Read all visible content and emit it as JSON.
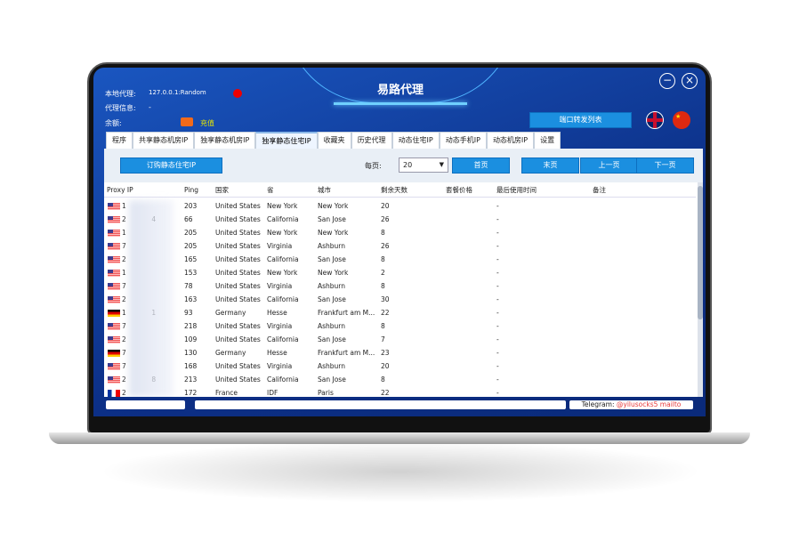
{
  "app": {
    "title": "易路代理"
  },
  "info": {
    "local_proxy_label": "本地代理:",
    "local_proxy_value": "127.0.0.1:Random",
    "proxy_info_label": "代理信息:",
    "proxy_info_value": "-",
    "balance_label": "余额:",
    "recharge_label": "充值"
  },
  "buttons": {
    "port_forward": "端口转发列表",
    "buy": "订购静态住宅IP",
    "first": "首页",
    "last": "末页",
    "prev": "上一页",
    "next": "下一页"
  },
  "per_page": {
    "label": "每页:",
    "value": "20"
  },
  "tabs": [
    "程序",
    "共享静态机房IP",
    "独享静态机房IP",
    "独享静态住宅IP",
    "收藏夹",
    "历史代理",
    "动态住宅IP",
    "动态手机IP",
    "动态机房IP",
    "设置"
  ],
  "active_tab": "独享静态住宅IP",
  "columns": [
    "Proxy IP",
    "Ping",
    "国家",
    "省",
    "城市",
    "剩余天数",
    "套餐价格",
    "最后使用时间",
    "备注"
  ],
  "rows": [
    {
      "flag": "us",
      "ip": "1",
      "ping": "203",
      "country": "United States",
      "state": "New York",
      "city": "New York",
      "days": "20",
      "last": "-"
    },
    {
      "flag": "us",
      "ip": "2            4",
      "ping": "66",
      "country": "United States",
      "state": "California",
      "city": "San Jose",
      "days": "26",
      "last": "-"
    },
    {
      "flag": "us",
      "ip": "1",
      "ping": "205",
      "country": "United States",
      "state": "New York",
      "city": "New York",
      "days": "8",
      "last": "-"
    },
    {
      "flag": "us",
      "ip": "7",
      "ping": "205",
      "country": "United States",
      "state": "Virginia",
      "city": "Ashburn",
      "days": "26",
      "last": "-"
    },
    {
      "flag": "us",
      "ip": "2",
      "ping": "165",
      "country": "United States",
      "state": "California",
      "city": "San Jose",
      "days": "8",
      "last": "-"
    },
    {
      "flag": "us",
      "ip": "1",
      "ping": "153",
      "country": "United States",
      "state": "New York",
      "city": "New York",
      "days": "2",
      "last": "-"
    },
    {
      "flag": "us",
      "ip": "7",
      "ping": "78",
      "country": "United States",
      "state": "Virginia",
      "city": "Ashburn",
      "days": "8",
      "last": "-"
    },
    {
      "flag": "us",
      "ip": "2",
      "ping": "163",
      "country": "United States",
      "state": "California",
      "city": "San Jose",
      "days": "30",
      "last": "-"
    },
    {
      "flag": "de",
      "ip": "1            1",
      "ping": "93",
      "country": "Germany",
      "state": "Hesse",
      "city": "Frankfurt am M...",
      "days": "22",
      "last": "-"
    },
    {
      "flag": "us",
      "ip": "7",
      "ping": "218",
      "country": "United States",
      "state": "Virginia",
      "city": "Ashburn",
      "days": "8",
      "last": "-"
    },
    {
      "flag": "us",
      "ip": "2",
      "ping": "109",
      "country": "United States",
      "state": "California",
      "city": "San Jose",
      "days": "7",
      "last": "-"
    },
    {
      "flag": "de",
      "ip": "7",
      "ping": "130",
      "country": "Germany",
      "state": "Hesse",
      "city": "Frankfurt am M...",
      "days": "23",
      "last": "-"
    },
    {
      "flag": "us",
      "ip": "7",
      "ping": "168",
      "country": "United States",
      "state": "Virginia",
      "city": "Ashburn",
      "days": "20",
      "last": "-"
    },
    {
      "flag": "us",
      "ip": "2            8",
      "ping": "213",
      "country": "United States",
      "state": "California",
      "city": "San Jose",
      "days": "8",
      "last": "-"
    },
    {
      "flag": "fr",
      "ip": "2",
      "ping": "172",
      "country": "France",
      "state": "IDF",
      "city": "Paris",
      "days": "22",
      "last": "-"
    }
  ],
  "status": {
    "telegram_label": "Telegram:",
    "telegram_handle": "@yilusocks5",
    "mailto": "mailto"
  },
  "colors": {
    "accent": "#1b8fe0",
    "header_bg": "#0c2f86",
    "link": "#e83a3a"
  }
}
